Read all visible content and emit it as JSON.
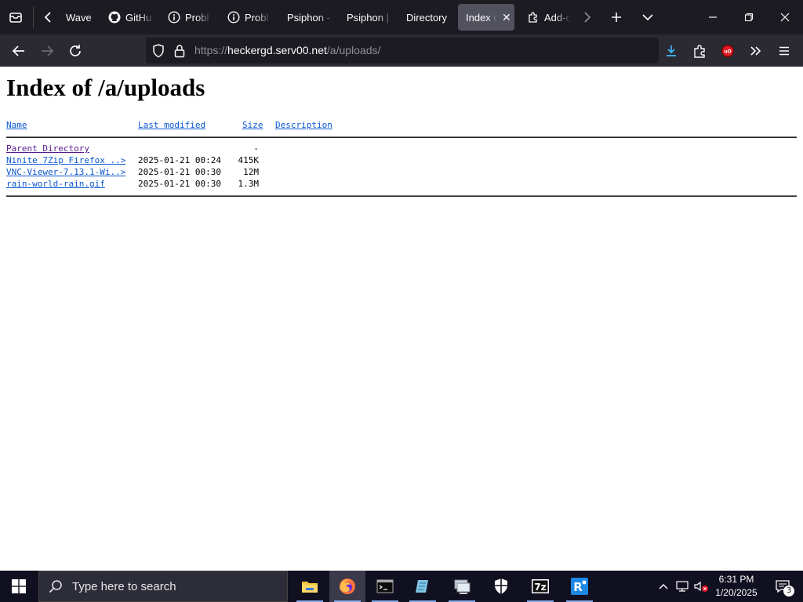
{
  "tabs": [
    {
      "label": "Wave",
      "icon": "none"
    },
    {
      "label": "GitHu",
      "icon": "github-icon"
    },
    {
      "label": "Probl",
      "icon": "info-icon"
    },
    {
      "label": "Probl",
      "icon": "info-icon"
    },
    {
      "label": "Psiphon -",
      "icon": "none"
    },
    {
      "label": "Psiphon |",
      "icon": "none"
    },
    {
      "label": "Directory",
      "icon": "none"
    },
    {
      "label": "Index o",
      "icon": "none",
      "active": true
    },
    {
      "label": "Add-o",
      "icon": "puzzle-icon"
    }
  ],
  "address_bar": {
    "url_prefix": "https://",
    "url_host": "heckergd.serv00.net",
    "url_path": "/a/uploads/"
  },
  "page": {
    "title": "Index of /a/uploads",
    "columns": {
      "name": "Name",
      "last_modified": "Last modified",
      "size": "Size",
      "description": "Description"
    },
    "rows": [
      {
        "name": "Parent Directory",
        "modified": "",
        "size": "-",
        "visited": true
      },
      {
        "name": "Ninite 7Zip Firefox ..>",
        "modified": "2025-01-21 00:24",
        "size": "415K"
      },
      {
        "name": "VNC-Viewer-7.13.1-Wi..>",
        "modified": "2025-01-21 00:30",
        "size": "12M"
      },
      {
        "name": "rain-world-rain.gif",
        "modified": "2025-01-21 00:30",
        "size": "1.3M"
      }
    ]
  },
  "taskbar": {
    "search_placeholder": "Type here to search",
    "apps": [
      "file-explorer-icon",
      "firefox-icon",
      "terminal-icon",
      "notepad-icon",
      "network-folder-icon",
      "defender-icon",
      "7zip-icon",
      "remote-app-icon"
    ],
    "time": "6:31 PM",
    "date": "1/20/2025",
    "notification_count": "3"
  },
  "colors": {
    "tab_strip": "#1c1b22",
    "nav_bar": "#2b2a33",
    "link": "#0b57d0",
    "visited_link": "#551a8b",
    "taskbar": "#101020"
  }
}
